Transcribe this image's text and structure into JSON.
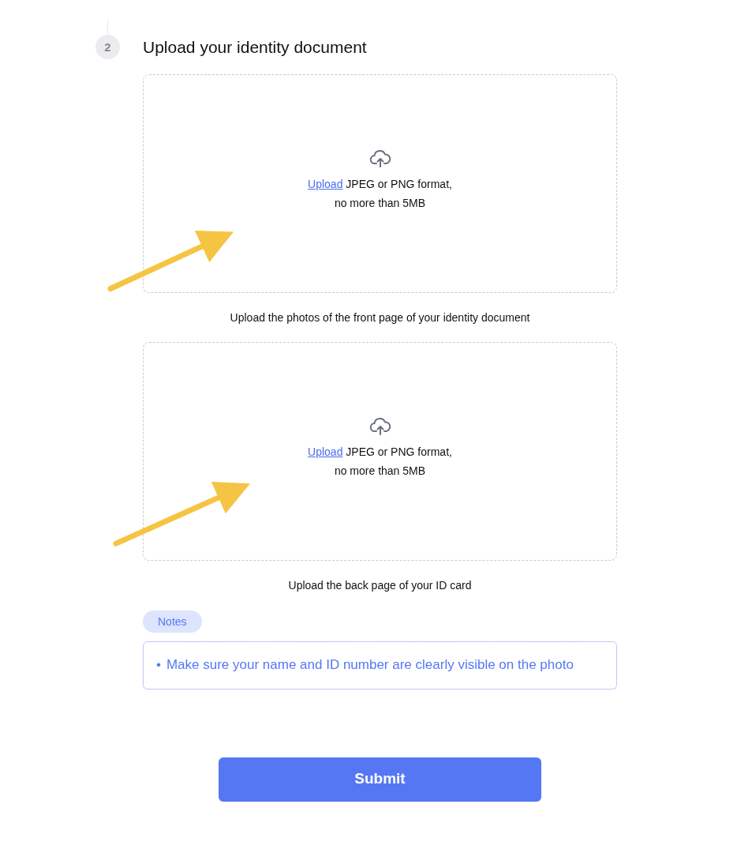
{
  "step": {
    "number": "2",
    "title": "Upload your identity document"
  },
  "uploads": [
    {
      "link": "Upload",
      "hint": [
        "JPEG or PNG format,",
        "no more than 5MB"
      ],
      "caption": "Upload the photos of the front page of your identity document"
    },
    {
      "link": "Upload",
      "hint": [
        "JPEG or PNG format,",
        "no more than 5MB"
      ],
      "caption": "Upload the back page of your ID card"
    }
  ],
  "notes": {
    "label": "Notes",
    "items": [
      {
        "bullet": "•",
        "text": "Make sure your name and ID number are clearly visible on the photo"
      }
    ]
  },
  "submit": "Submit"
}
